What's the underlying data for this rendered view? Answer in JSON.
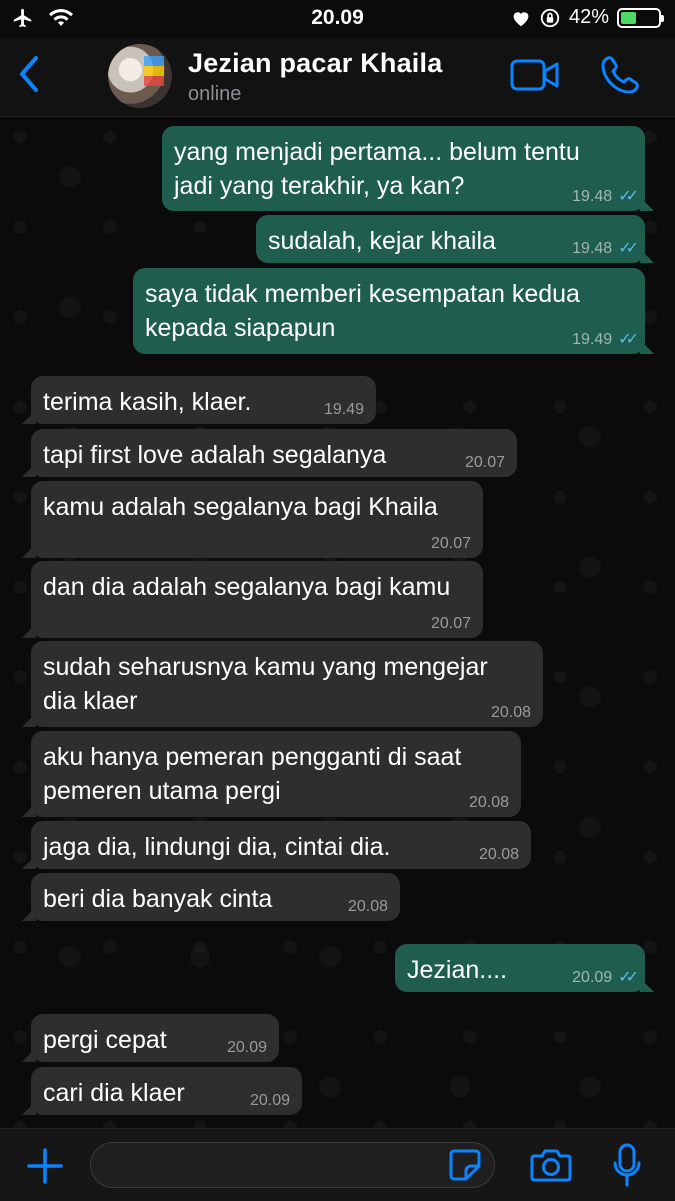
{
  "status_bar": {
    "time": "20.09",
    "battery_percent": "42%",
    "battery_level": 0.42,
    "icons": [
      "airplane-icon",
      "wifi-icon",
      "heart-icon",
      "rotation-lock-icon",
      "battery-icon"
    ]
  },
  "header": {
    "contact_name": "Jezian pacar Khaila",
    "contact_status": "online",
    "accent_color": "#0a84ff"
  },
  "messages": [
    {
      "dir": "out",
      "lines": [
        "yang menjadi pertama... belum tentu",
        "jadi yang terakhir, ya kan?"
      ],
      "time": "19.48",
      "read": true
    },
    {
      "dir": "out",
      "lines": [
        "sudalah, kejar khaila"
      ],
      "time": "19.48",
      "read": true
    },
    {
      "dir": "out",
      "lines": [
        "saya tidak memberi kesempatan kedua",
        "kepada siapapun"
      ],
      "time": "19.49",
      "read": true
    },
    {
      "dir": "in",
      "lines": [
        "terima kasih, klaer."
      ],
      "time": "19.49"
    },
    {
      "dir": "in",
      "lines": [
        "tapi first love adalah segalanya"
      ],
      "time": "20.07"
    },
    {
      "dir": "in",
      "lines": [
        "kamu adalah segalanya bagi Khaila"
      ],
      "time": "20.07"
    },
    {
      "dir": "in",
      "lines": [
        "dan dia adalah segalanya bagi kamu"
      ],
      "time": "20.07"
    },
    {
      "dir": "in",
      "lines": [
        "sudah seharusnya kamu yang mengejar",
        "dia klaer"
      ],
      "time": "20.08"
    },
    {
      "dir": "in",
      "lines": [
        "aku hanya pemeran pengganti di saat",
        "pemeren utama pergi"
      ],
      "time": "20.08"
    },
    {
      "dir": "in",
      "lines": [
        "jaga dia, lindungi dia, cintai dia."
      ],
      "time": "20.08"
    },
    {
      "dir": "in",
      "lines": [
        "beri dia banyak cinta"
      ],
      "time": "20.08"
    },
    {
      "dir": "out",
      "lines": [
        "Jezian...."
      ],
      "time": "20.09",
      "read": true
    },
    {
      "dir": "in",
      "lines": [
        "pergi cepat"
      ],
      "time": "20.09"
    },
    {
      "dir": "in",
      "lines": [
        "cari dia klaer"
      ],
      "time": "20.09"
    }
  ],
  "colors": {
    "outgoing_bubble": "#1f5e4f",
    "incoming_bubble": "#2e2e2e",
    "read_ticks": "#53bdeb"
  },
  "input_bar": {
    "icons": [
      "plus-icon",
      "sticker-icon",
      "camera-icon",
      "microphone-icon"
    ]
  }
}
